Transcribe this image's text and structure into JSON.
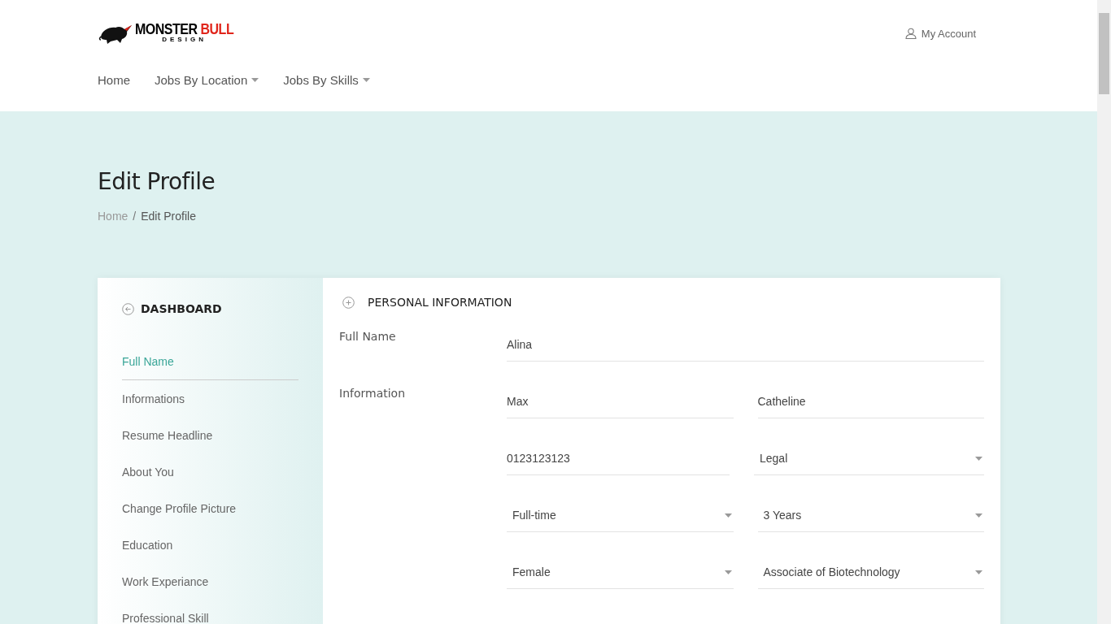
{
  "logo": {
    "word_1": "MONSTER",
    "word_2": "BULL",
    "tagline": "DESIGN"
  },
  "account": {
    "label": "My Account"
  },
  "nav": [
    {
      "label": "Home",
      "dropdown": false
    },
    {
      "label": "Jobs By Location",
      "dropdown": true
    },
    {
      "label": "Jobs By Skills",
      "dropdown": true
    }
  ],
  "page_title": "Edit Profile",
  "breadcrumb": [
    "Home",
    "Edit Profile"
  ],
  "breadcrumb_separator": "/",
  "sidebar": {
    "title": "DASHBOARD",
    "items": [
      {
        "label": "Full Name",
        "selected": true
      },
      {
        "label": "Informations",
        "selected": false
      },
      {
        "label": "Resume Headline",
        "selected": false
      },
      {
        "label": "About You",
        "selected": false
      },
      {
        "label": "Change Profile Picture",
        "selected": false
      },
      {
        "label": "Education",
        "selected": false
      },
      {
        "label": "Work Experiance",
        "selected": false
      },
      {
        "label": "Professional Skill",
        "selected": false
      }
    ]
  },
  "section": {
    "title": "PERSONAL INFORMATION",
    "groups": [
      {
        "label": "Full Name",
        "rows": [
          [
            {
              "kind": "input",
              "value": "Alina"
            }
          ]
        ]
      },
      {
        "label": "Information",
        "rows": [
          [
            {
              "kind": "input",
              "value": "Max"
            },
            {
              "kind": "input",
              "value": "Catheline"
            }
          ],
          [
            {
              "kind": "input",
              "value": "0123123123"
            },
            {
              "kind": "select",
              "value": "Legal"
            }
          ],
          [
            {
              "kind": "select",
              "value": "Full-time"
            },
            {
              "kind": "select",
              "value": "3 Years"
            }
          ],
          [
            {
              "kind": "select",
              "value": "Female"
            },
            {
              "kind": "select",
              "value": "Associate of Biotechnology"
            }
          ]
        ]
      }
    ]
  }
}
